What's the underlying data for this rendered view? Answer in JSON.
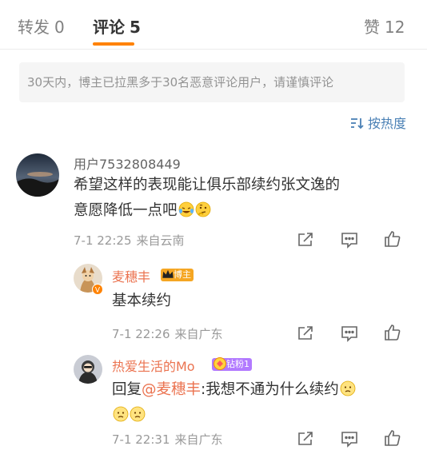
{
  "tabs": [
    {
      "label": "转发",
      "count": "0"
    },
    {
      "label": "评论",
      "count": "5"
    },
    {
      "label": "赞",
      "count": "12"
    }
  ],
  "notice": "30天内，博主已拉黑多于30名恶意评论用户，请谨慎评论",
  "sort_label": "按热度",
  "comments": [
    {
      "user": "用户7532808449",
      "text_line1": "希望这样的表现能让俱乐部续约张文逸的",
      "text_line2": "意愿降低一点吧",
      "time": "7-1 22:25",
      "source": "来自云南"
    },
    {
      "user": "麦穗丰",
      "badge": "博主",
      "text": "基本续约",
      "time": "7-1 22:26",
      "source": "来自广东"
    },
    {
      "user": "热爱生活的Mo",
      "badge": "钻粉1",
      "reply_prefix": "回复",
      "mention": "@麦穗丰",
      "reply_text": ":我想不通为什么续约",
      "time": "7-1 22:31",
      "source": "来自广东"
    }
  ],
  "colors": {
    "accent": "#ff8200",
    "link": "#4a80b5",
    "name_highlight": "#eb7350",
    "meta": "#999999"
  }
}
